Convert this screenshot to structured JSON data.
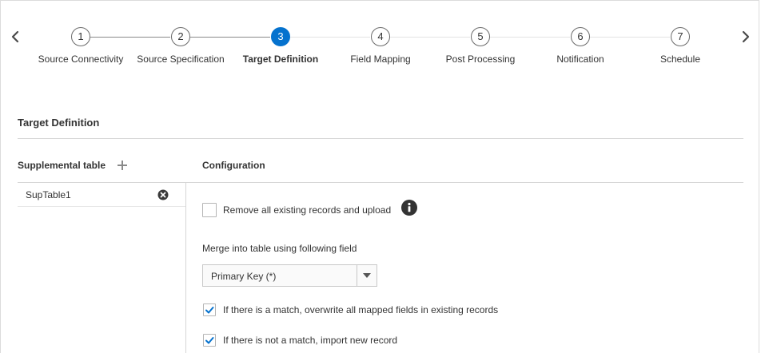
{
  "train": {
    "steps": [
      {
        "number": "1",
        "label": "Source Connectivity"
      },
      {
        "number": "2",
        "label": "Source Specification"
      },
      {
        "number": "3",
        "label": "Target Definition"
      },
      {
        "number": "4",
        "label": "Field Mapping"
      },
      {
        "number": "5",
        "label": "Post Processing"
      },
      {
        "number": "6",
        "label": "Notification"
      },
      {
        "number": "7",
        "label": "Schedule"
      }
    ],
    "active_step": 3,
    "accent_color": "#0572ce",
    "prev_icon": "chevron-left-icon",
    "next_icon": "chevron-right-icon"
  },
  "section": {
    "title": "Target Definition"
  },
  "supplemental": {
    "header": "Supplemental table",
    "add_icon": "plus-icon",
    "tables": [
      {
        "name": "SupTable1",
        "remove_icon": "remove-circle-icon"
      }
    ]
  },
  "configuration": {
    "header": "Configuration",
    "remove_existing": {
      "label": "Remove all existing records and upload",
      "checked": false,
      "info_icon": "info-icon"
    },
    "merge_label": "Merge into table using following field",
    "merge_field": {
      "value": "Primary Key (*)"
    },
    "overwrite_on_match": {
      "label": "If there is a match, overwrite all mapped fields in existing records",
      "checked": true
    },
    "import_on_no_match": {
      "label": "If there is not a match, import new record",
      "checked": true
    }
  }
}
